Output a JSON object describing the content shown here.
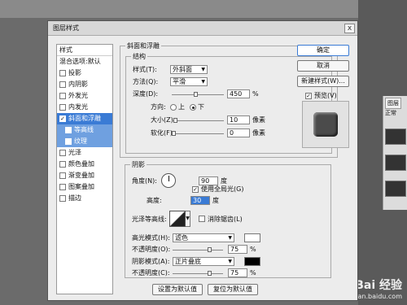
{
  "dialog": {
    "title": "图层样式",
    "close_glyph": "x"
  },
  "style_list": {
    "header": "样式",
    "items": [
      {
        "label": "混合选项:默认",
        "check": false,
        "checked": false
      },
      {
        "label": "投影",
        "check": true,
        "checked": false
      },
      {
        "label": "内阴影",
        "check": true,
        "checked": false
      },
      {
        "label": "外发光",
        "check": true,
        "checked": false
      },
      {
        "label": "内发光",
        "check": true,
        "checked": false
      },
      {
        "label": "斜面和浮雕",
        "check": true,
        "checked": true
      },
      {
        "label": "等高线",
        "check": true,
        "checked": false
      },
      {
        "label": "纹理",
        "check": true,
        "checked": false
      },
      {
        "label": "光泽",
        "check": true,
        "checked": false
      },
      {
        "label": "颜色叠加",
        "check": true,
        "checked": false
      },
      {
        "label": "渐变叠加",
        "check": true,
        "checked": false
      },
      {
        "label": "图案叠加",
        "check": true,
        "checked": false
      },
      {
        "label": "描边",
        "check": true,
        "checked": false
      }
    ]
  },
  "bevel": {
    "section_title": "斜面和浮雕",
    "structure_title": "结构",
    "style_label": "样式(T):",
    "style_value": "外斜面",
    "method_label": "方法(Q):",
    "method_value": "平滑",
    "depth_label": "深度(D):",
    "depth_value": "450",
    "depth_unit": "%",
    "depth_slider": 0.45,
    "direction_label": "方向:",
    "dir_up": "上",
    "dir_down": "下",
    "size_label": "大小(Z):",
    "size_value": "10",
    "size_unit": "像素",
    "size_slider": 0.04,
    "soften_label": "软化(F):",
    "soften_value": "0",
    "soften_unit": "像素",
    "soften_slider": 0.0
  },
  "shading": {
    "title": "阴影",
    "angle_label": "角度(N):",
    "angle_value": "90",
    "angle_unit": "度",
    "global_light_label": "使用全局光(G)",
    "global_light_checked": true,
    "altitude_label": "高度:",
    "altitude_value": "30",
    "altitude_unit": "度",
    "gloss_label": "光泽等高线:",
    "antialias_label": "消除锯齿(L)",
    "antialias_checked": false,
    "highlight_mode_label": "高光模式(H):",
    "highlight_mode_value": "滤色",
    "highlight_color": "#ffffff",
    "highlight_opacity_label": "不透明度(O):",
    "highlight_opacity_value": "75",
    "highlight_opacity_unit": "%",
    "highlight_opacity_slider": 0.75,
    "shadow_mode_label": "阴影模式(A):",
    "shadow_mode_value": "正片叠底",
    "shadow_color": "#000000",
    "shadow_opacity_label": "不透明度(C):",
    "shadow_opacity_value": "75",
    "shadow_opacity_unit": "%",
    "shadow_opacity_slider": 0.75
  },
  "footer": {
    "set_default": "设置为默认值",
    "reset_default": "复位为默认值"
  },
  "buttons": {
    "ok": "确定",
    "cancel": "取消",
    "new_style": "新建样式(W)...",
    "preview_label": "预览(V)",
    "preview_checked": true
  },
  "right_panel": {
    "tab": "图层",
    "mode": "正常"
  },
  "watermark": {
    "line1": "Bai 经验",
    "line2": "jingyan.baidu.com"
  },
  "colors": {
    "selection": "#3a7bd5"
  }
}
